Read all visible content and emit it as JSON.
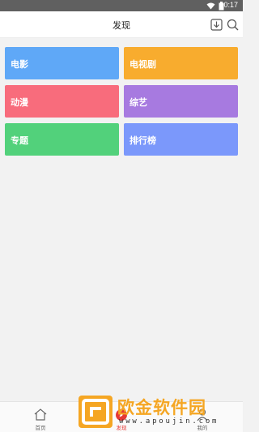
{
  "status_bar": {
    "time": "10:17"
  },
  "header": {
    "title": "发现",
    "download_icon": "download-icon",
    "search_icon": "search-icon"
  },
  "categories": [
    {
      "label": "电影",
      "color": "#5fa8f7"
    },
    {
      "label": "电视剧",
      "color": "#f8ac2e"
    },
    {
      "label": "动漫",
      "color": "#f86c7c"
    },
    {
      "label": "综艺",
      "color": "#a77ae0"
    },
    {
      "label": "专题",
      "color": "#52d17b"
    },
    {
      "label": "排行榜",
      "color": "#7b98fb"
    }
  ],
  "tabbar": {
    "tabs": [
      {
        "label": "首页",
        "icon": "home-icon",
        "active": false
      },
      {
        "label": "发现",
        "icon": "discover-icon",
        "active": true
      },
      {
        "label": "我的",
        "icon": "user-icon",
        "active": false
      }
    ]
  },
  "watermark": {
    "title": "欧金软件园",
    "url": "www.apoujin.com"
  }
}
